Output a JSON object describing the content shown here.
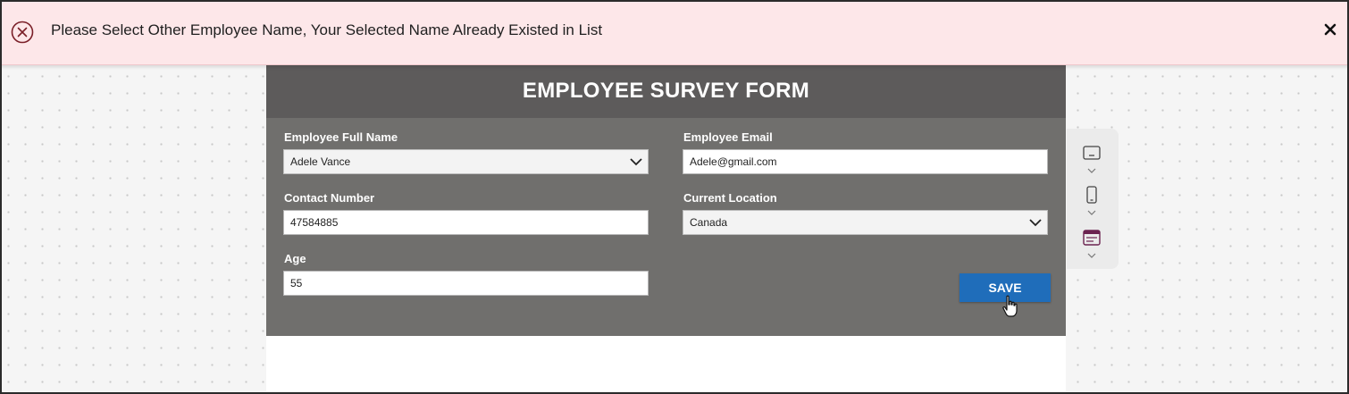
{
  "notification": {
    "message": "Please Select Other Employee Name, Your Selected Name Already Existed in List",
    "icon": "error-circle-icon",
    "close_glyph": "✕",
    "background": "#fde7e9"
  },
  "form": {
    "title": "EMPLOYEE SURVEY FORM",
    "header_color": "#5d5b5b",
    "body_color": "#706f6d",
    "fields": {
      "full_name": {
        "label": "Employee Full Name",
        "value": "Adele Vance"
      },
      "email": {
        "label": "Employee Email",
        "value": "Adele@gmail.com"
      },
      "contact": {
        "label": "Contact Number",
        "value": "47584885"
      },
      "location": {
        "label": "Current Location",
        "value": "Canada"
      },
      "age": {
        "label": "Age",
        "value": "55"
      }
    },
    "save_label": "SAVE",
    "save_color": "#1f6dba"
  },
  "toolbar": {
    "items": [
      {
        "icon": "tablet-layout-icon"
      },
      {
        "icon": "phone-layout-icon"
      },
      {
        "icon": "screen-template-icon"
      }
    ]
  }
}
